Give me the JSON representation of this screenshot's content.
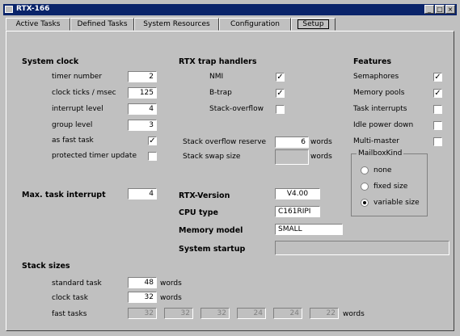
{
  "window": {
    "title": "RTX-166"
  },
  "titlebar_buttons": {
    "minimize": "_",
    "maximize": "□",
    "close": "×"
  },
  "tabs": [
    "Active Tasks",
    "Defined Tasks",
    "System Resources",
    "Configuration",
    "Setup"
  ],
  "active_tab": "Setup",
  "system_clock": {
    "heading": "System clock",
    "timer_number": {
      "label": "timer number",
      "value": "2"
    },
    "clock_ticks": {
      "label": "clock ticks / msec",
      "value": "125"
    },
    "interrupt_level": {
      "label": "interrupt level",
      "value": "4"
    },
    "group_level": {
      "label": "group level",
      "value": "3"
    },
    "as_fast_task": {
      "label": "as fast task",
      "checked": "✓"
    },
    "protected_timer": {
      "label": "protected timer update",
      "checked": ""
    }
  },
  "trap_handlers": {
    "heading": "RTX trap handlers",
    "nmi": {
      "label": "NMI",
      "checked": "✓"
    },
    "btrap": {
      "label": "B-trap",
      "checked": "✓"
    },
    "stack_overflow": {
      "label": "Stack-overflow",
      "checked": ""
    }
  },
  "stack_overflow_reserve": {
    "label": "Stack overflow reserve",
    "value": "6",
    "unit": "words"
  },
  "stack_swap_size": {
    "label": "Stack swap size",
    "value": "",
    "unit": "words"
  },
  "features": {
    "heading": "Features",
    "semaphores": {
      "label": "Semaphores",
      "checked": "✓"
    },
    "memory_pools": {
      "label": "Memory pools",
      "checked": "✓"
    },
    "task_interrupts": {
      "label": "Task interrupts",
      "checked": ""
    },
    "idle_power_down": {
      "label": "Idle power down",
      "checked": ""
    },
    "multi_master": {
      "label": "Multi-master",
      "checked": ""
    }
  },
  "mailbox_kind": {
    "title": "MailboxKind",
    "options": [
      "none",
      "fixed size",
      "variable size"
    ],
    "selected": "variable size"
  },
  "max_task_interrupt": {
    "label": "Max. task interrupt",
    "value": "4"
  },
  "rtx_version": {
    "label": "RTX-Version",
    "value": "V4.00"
  },
  "cpu_type": {
    "label": "CPU type",
    "value": "C161RIPI"
  },
  "memory_model": {
    "label": "Memory model",
    "value": "SMALL"
  },
  "system_startup": {
    "label": "System startup",
    "value": ""
  },
  "stack_sizes": {
    "heading": "Stack sizes",
    "standard_task": {
      "label": "standard task",
      "value": "48",
      "unit": "words"
    },
    "clock_task": {
      "label": "clock task",
      "value": "32",
      "unit": "words"
    },
    "fast_tasks": {
      "label": "fast tasks",
      "values": [
        "32",
        "32",
        "32",
        "24",
        "24",
        "22"
      ],
      "unit": "words"
    }
  }
}
